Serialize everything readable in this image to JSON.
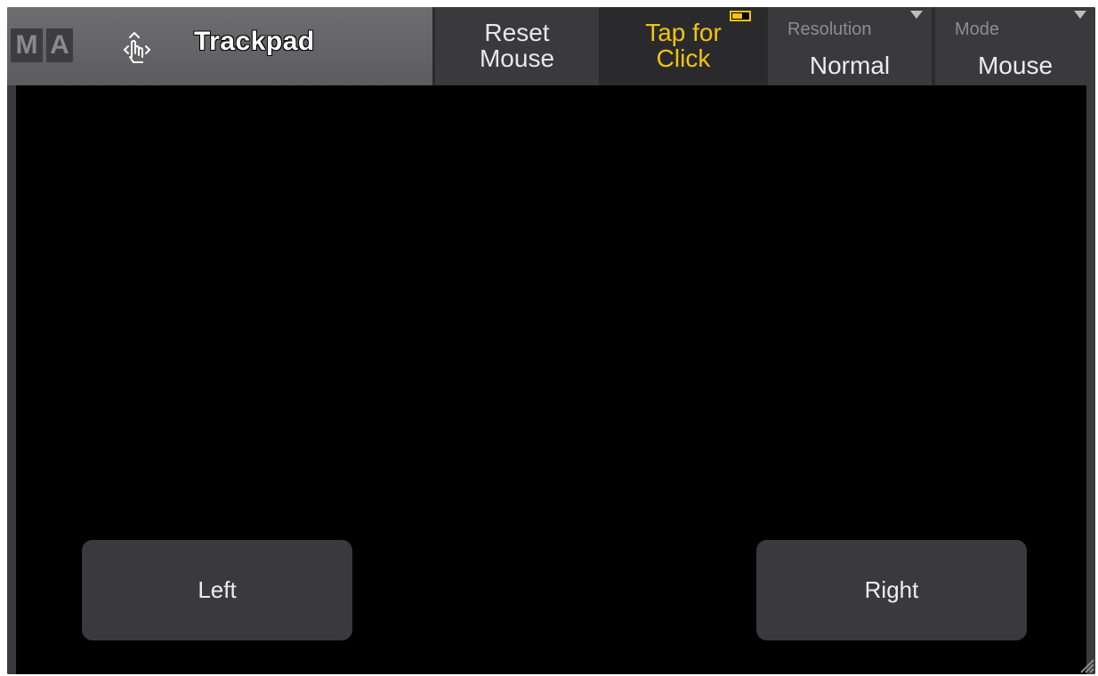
{
  "logo": {
    "letter_m": "M",
    "letter_a": "A"
  },
  "header": {
    "title": "Trackpad",
    "icon": "trackpad-gesture-icon"
  },
  "toolbar": {
    "reset_line1": "Reset",
    "reset_line2": "Mouse",
    "tap_line1": "Tap for",
    "tap_line2": "Click",
    "tap_state": "on",
    "resolution_label": "Resolution",
    "resolution_value": "Normal",
    "mode_label": "Mode",
    "mode_value": "Mouse"
  },
  "pad": {
    "left_label": "Left",
    "right_label": "Right"
  },
  "colors": {
    "accent": "#f2c40f",
    "background": "#000000",
    "button": "#3a3a3d"
  }
}
